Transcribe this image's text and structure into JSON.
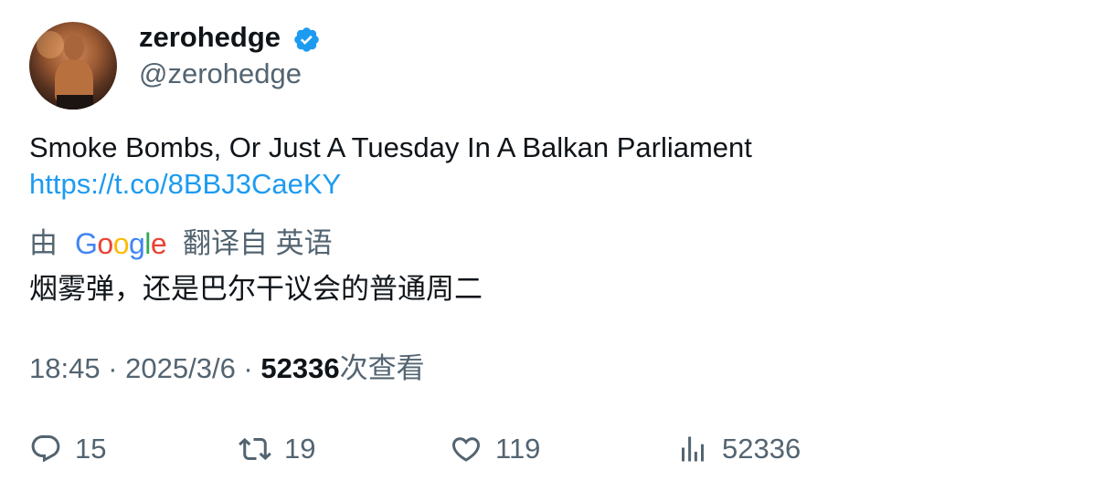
{
  "author": {
    "display_name": "zerohedge",
    "handle": "@zerohedge",
    "verified": true,
    "verified_icon": "verified-badge-icon",
    "avatar": "profile-photo"
  },
  "tweet": {
    "text": "Smoke Bombs, Or Just A Tuesday In A Balkan Parliament",
    "link": "https://t.co/8BBJ3CaeKY"
  },
  "translation": {
    "by_label": "由",
    "provider": "Google",
    "from_label": "翻译自 英语",
    "translated_text": "烟雾弹，还是巴尔干议会的普通周二"
  },
  "meta": {
    "time": "18:45",
    "separator": " · ",
    "date": "2025/3/6",
    "views_count": "52336",
    "views_suffix": "次查看"
  },
  "actions": {
    "reply": {
      "icon": "reply-icon",
      "count": "15"
    },
    "retweet": {
      "icon": "retweet-icon",
      "count": "19"
    },
    "like": {
      "icon": "heart-icon",
      "count": "119"
    },
    "views": {
      "icon": "analytics-icon",
      "count": "52336"
    }
  },
  "colors": {
    "text_primary": "#0f1419",
    "text_secondary": "#536471",
    "link": "#1d9bf0",
    "verified": "#1d9bf0"
  }
}
